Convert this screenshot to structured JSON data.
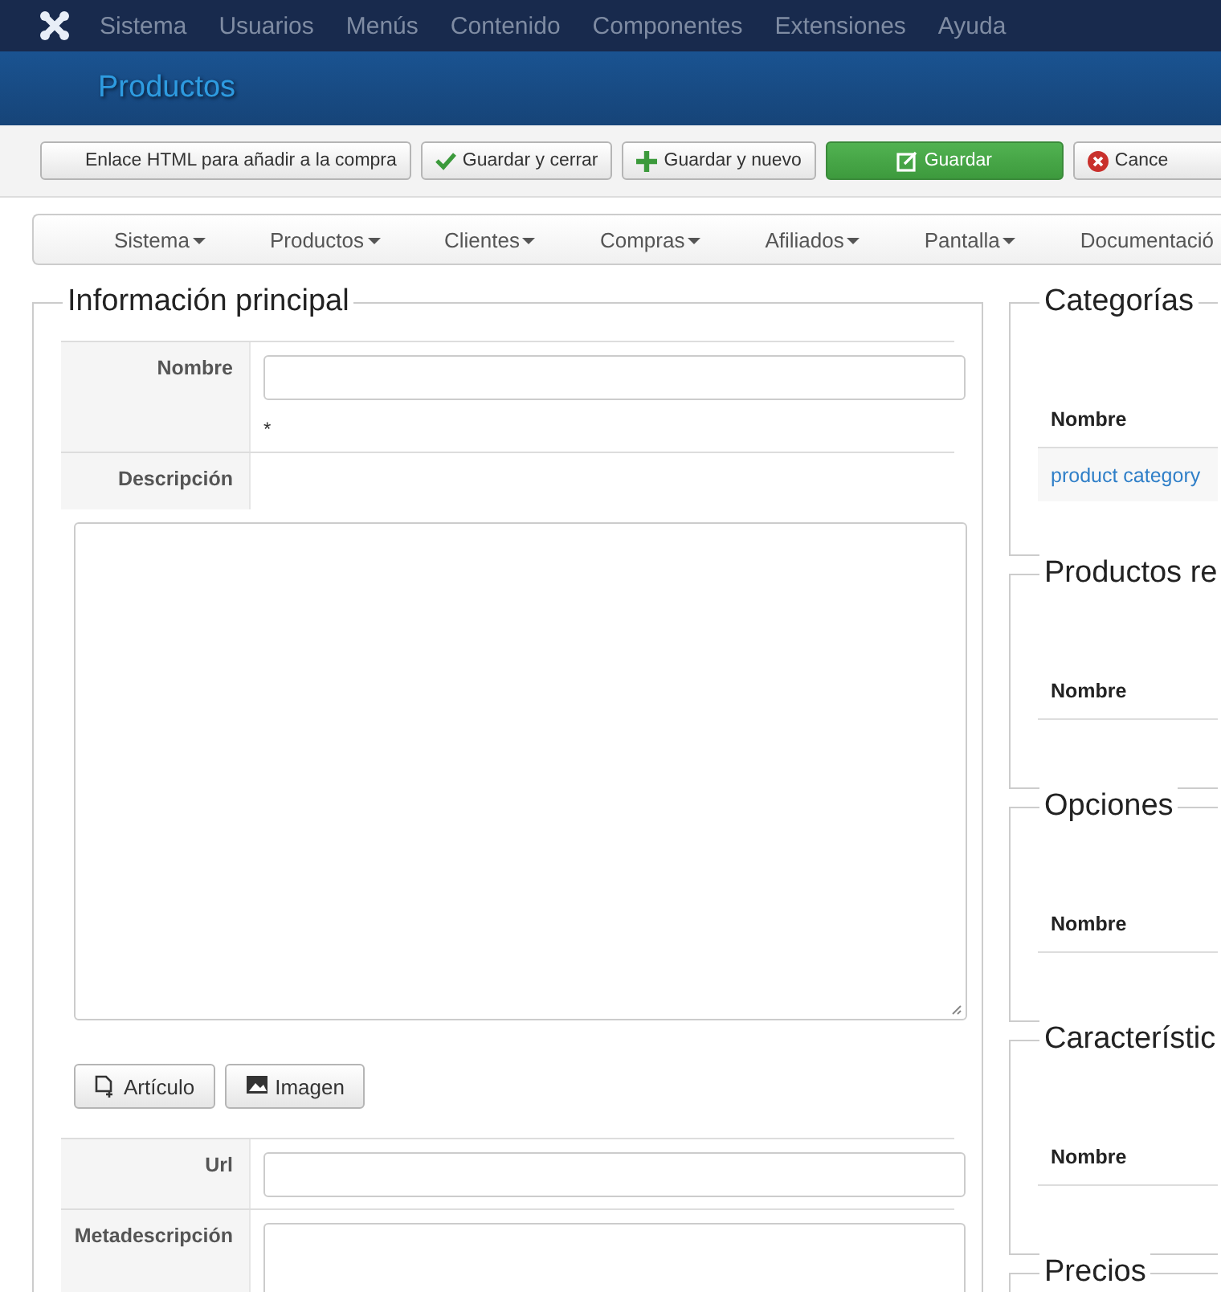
{
  "top_menu": {
    "items": [
      "Sistema",
      "Usuarios",
      "Menús",
      "Contenido",
      "Componentes",
      "Extensiones",
      "Ayuda"
    ]
  },
  "page_title": "Productos",
  "toolbar": {
    "buttons": [
      {
        "label": "Enlace HTML para añadir a la compra",
        "kind": "plain"
      },
      {
        "label": "Guardar y cerrar",
        "kind": "check"
      },
      {
        "label": "Guardar y nuevo",
        "kind": "plus"
      },
      {
        "label": "Guardar",
        "kind": "save"
      },
      {
        "label": "Cance",
        "kind": "cancel"
      }
    ]
  },
  "submenu": {
    "items": [
      "Sistema",
      "Productos",
      "Clientes",
      "Compras",
      "Afiliados",
      "Pantalla",
      "Documentació"
    ]
  },
  "main": {
    "legend": "Información principal",
    "fields": [
      {
        "label": "Nombre",
        "kind": "input",
        "required_mark": "*"
      },
      {
        "label": "Descripción",
        "kind": "label"
      }
    ],
    "editor_buttons": [
      {
        "label": "Artículo",
        "kind": "article"
      },
      {
        "label": "Imagen",
        "kind": "image"
      }
    ],
    "more_fields": [
      {
        "label": "Url",
        "kind": "input"
      },
      {
        "label": "Metadescripción",
        "kind": "textarea"
      }
    ]
  },
  "side_panels": [
    {
      "legend": "Categorías",
      "column": "Nombre",
      "rows": [
        "product category"
      ]
    },
    {
      "legend": "Productos re",
      "column": "Nombre"
    },
    {
      "legend": "Opciones",
      "column": "Nombre"
    },
    {
      "legend": "Característic",
      "column": "Nombre"
    },
    {
      "legend": "Precios"
    }
  ]
}
